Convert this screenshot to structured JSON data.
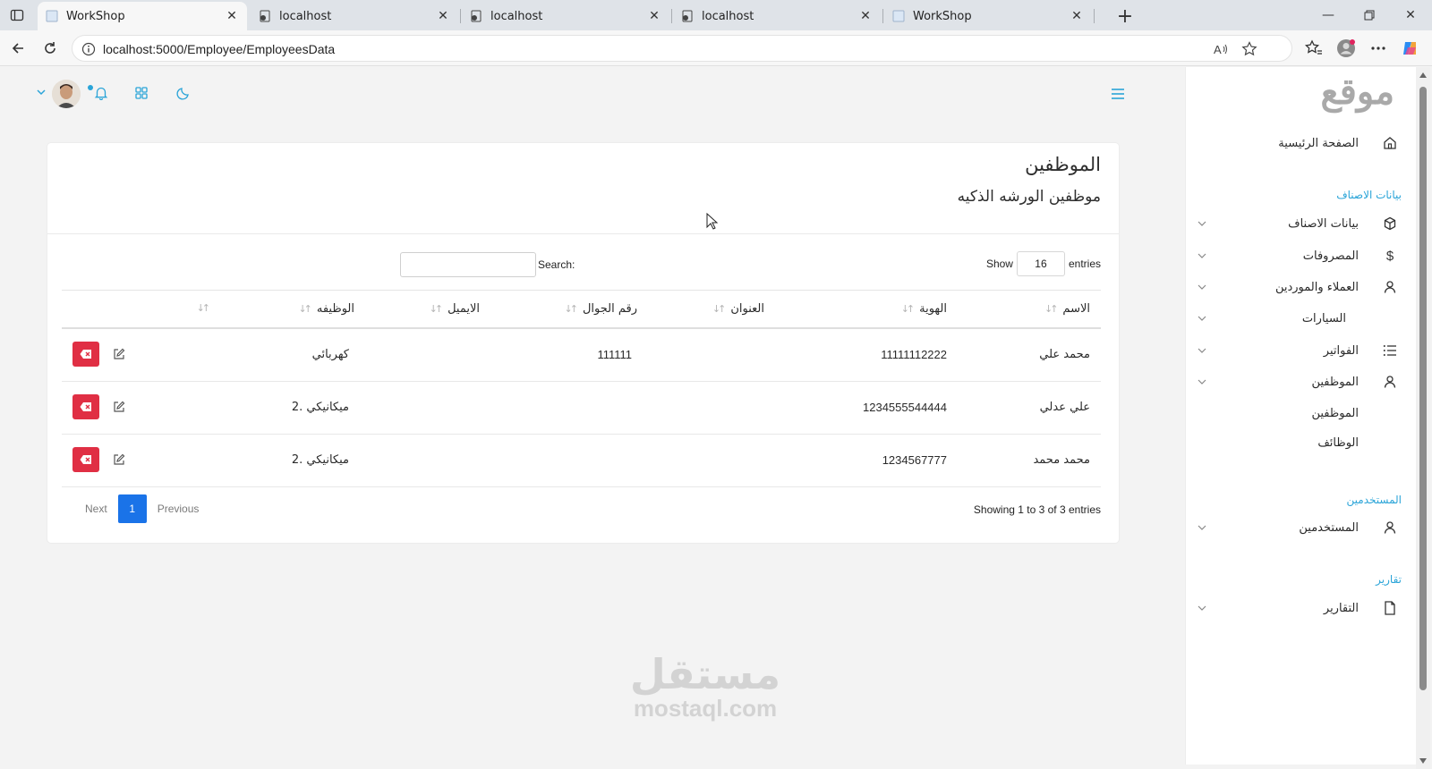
{
  "browser": {
    "tabs": [
      {
        "title": "WorkShop",
        "active": true
      },
      {
        "title": "localhost",
        "active": false
      },
      {
        "title": "localhost",
        "active": false
      },
      {
        "title": "localhost",
        "active": false
      },
      {
        "title": "WorkShop",
        "active": false
      }
    ],
    "url": "localhost:5000/Employee/EmployeesData"
  },
  "sidebar": {
    "brand": "موقع",
    "home": "الصفحة الرئيسية",
    "section_categories": "بيانات الاصناف",
    "items": [
      {
        "label": "بيانات الاصناف",
        "icon": "cube-icon"
      },
      {
        "label": "المصروفات",
        "icon": "dollar-icon"
      },
      {
        "label": "العملاء والموردين",
        "icon": "user-icon"
      },
      {
        "label": "السيارات",
        "icon": ""
      },
      {
        "label": "الفواتير",
        "icon": "list-icon"
      },
      {
        "label": "الموظفين",
        "icon": "user-icon"
      }
    ],
    "employees_sub": [
      "الموظفين",
      "الوظائف"
    ],
    "section_users": "المستخدمين",
    "users": "المستخدمين",
    "section_reports": "تقارير",
    "reports": "التقارير"
  },
  "card": {
    "title": "الموظفين",
    "subtitle": "موظفين الورشه الذكيه"
  },
  "table_controls": {
    "show_label": "Show",
    "length_value": "16",
    "entries_label": "entries",
    "search_label": "Search:",
    "info": "Showing 1 to 3 of 3 entries",
    "next": "Next",
    "previous": "Previous",
    "current_page": "1"
  },
  "table": {
    "headers": [
      "الاسم",
      "الهوية",
      "العنوان",
      "رقم الجوال",
      "الايميل",
      "الوظيفه",
      ""
    ],
    "rows": [
      {
        "name": "محمد علي",
        "id": "11111112222",
        "address": "",
        "phone": "111111",
        "email": "",
        "job": "كهربائي"
      },
      {
        "name": "علي عدلي",
        "id": "1234555544444",
        "address": "",
        "phone": "",
        "email": "",
        "job": "ميكانيكي .2"
      },
      {
        "name": "محمد محمد",
        "id": "1234567777",
        "address": "",
        "phone": "",
        "email": "",
        "job": "ميكانيكي .2"
      }
    ]
  },
  "watermark": {
    "arabic": "مستقل",
    "latin": "mostaql.com"
  },
  "colors": {
    "accent": "#2aa4d8",
    "danger": "#e02f44",
    "primary": "#1a73e8"
  }
}
